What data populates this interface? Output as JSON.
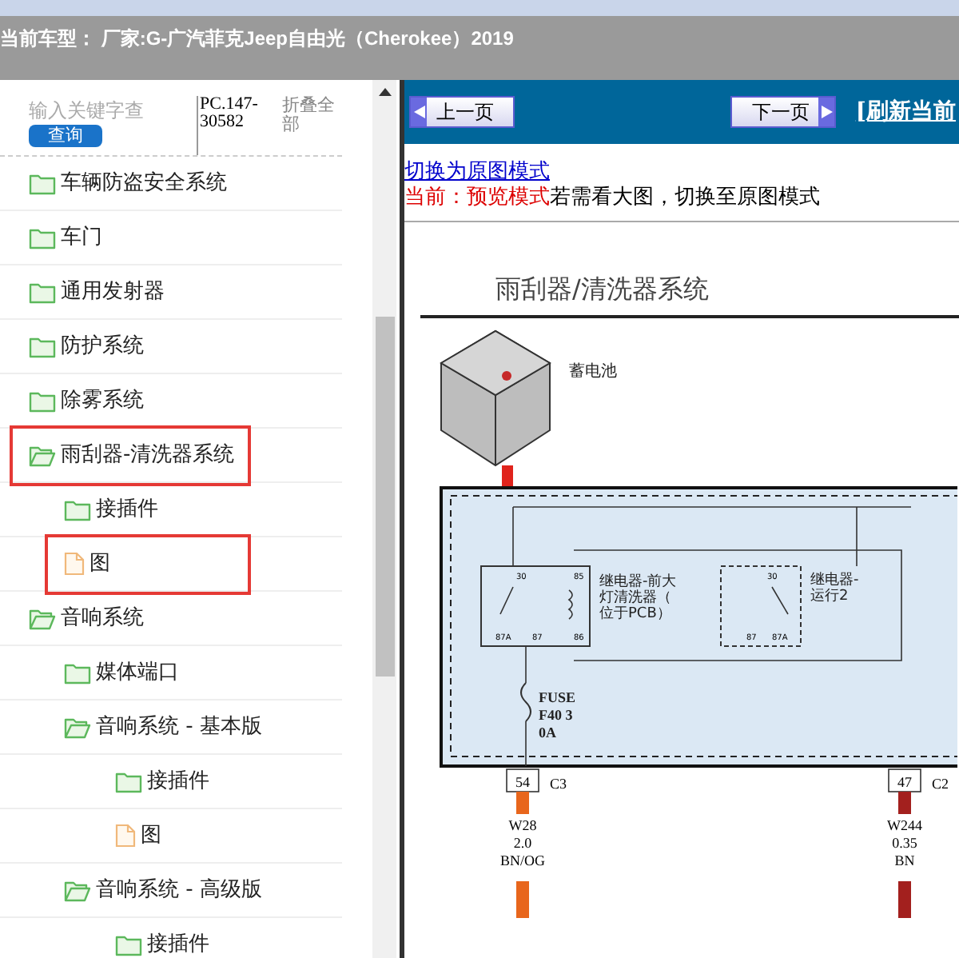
{
  "header": {
    "text": "当前车型： 厂家:G-广汽菲克Jeep自由光（Cherokee）2019"
  },
  "sidebar": {
    "search": {
      "placeholder": "输入关键字查",
      "button": "查询"
    },
    "code": "PC.147-30582",
    "collapse_all": "折叠全部",
    "tree": [
      {
        "label": "车辆防盗安全系统",
        "kind": "folder",
        "expanded": false,
        "highlighted": false
      },
      {
        "label": "车门",
        "kind": "folder",
        "expanded": false,
        "highlighted": false
      },
      {
        "label": "通用发射器",
        "kind": "folder",
        "expanded": false,
        "highlighted": false
      },
      {
        "label": "防护系统",
        "kind": "folder",
        "expanded": false,
        "highlighted": false
      },
      {
        "label": "除雾系统",
        "kind": "folder",
        "expanded": false,
        "highlighted": false
      },
      {
        "label": "雨刮器-清洗器系统",
        "kind": "folder",
        "expanded": true,
        "highlighted": true,
        "children": [
          {
            "label": "接插件",
            "kind": "folder",
            "expanded": false,
            "highlighted": false
          },
          {
            "label": "图",
            "kind": "file",
            "highlighted": true
          }
        ]
      },
      {
        "label": "音响系统",
        "kind": "folder",
        "expanded": true,
        "highlighted": false,
        "children": [
          {
            "label": "媒体端口",
            "kind": "folder",
            "expanded": false,
            "highlighted": false
          },
          {
            "label": "音响系统 - 基本版",
            "kind": "folder",
            "expanded": true,
            "highlighted": false,
            "children": [
              {
                "label": "接插件",
                "kind": "folder",
                "expanded": false,
                "highlighted": false
              },
              {
                "label": "图",
                "kind": "file",
                "highlighted": false
              }
            ]
          },
          {
            "label": "音响系统 - 高级版",
            "kind": "folder",
            "expanded": true,
            "highlighted": false,
            "children": [
              {
                "label": "接插件",
                "kind": "folder",
                "expanded": false,
                "highlighted": false
              }
            ]
          }
        ]
      }
    ]
  },
  "toolbar": {
    "prev": "上一页",
    "next": "下一页",
    "refresh": "[刷新当前"
  },
  "content": {
    "link": "切换为原图模式",
    "mode_label": "当前：预览模式",
    "mode_hint": "若需看大图，切换至原图模式"
  },
  "diagram": {
    "title": "雨刮器/清洗器系统",
    "battery": "蓄电池",
    "relay_1": {
      "lines": [
        "继电器-前大",
        "灯清洗器（",
        "位于PCB）"
      ],
      "pins": [
        "30",
        "85",
        "87A",
        "87",
        "86"
      ]
    },
    "relay_2": {
      "lines": [
        "继电器-",
        "运行2"
      ],
      "pins": [
        "30",
        "87",
        "87A"
      ]
    },
    "fuse": [
      "FUSE",
      "F40 3",
      "0A"
    ],
    "connectors": [
      {
        "pin": "54",
        "name": "C3",
        "wire": [
          "W28",
          "2.0",
          "BN/OG"
        ],
        "color": "#e8661c"
      },
      {
        "pin": "47",
        "name": "C2",
        "wire": [
          "W244",
          "0.35",
          "BN"
        ],
        "color": "#a3201e"
      }
    ]
  }
}
